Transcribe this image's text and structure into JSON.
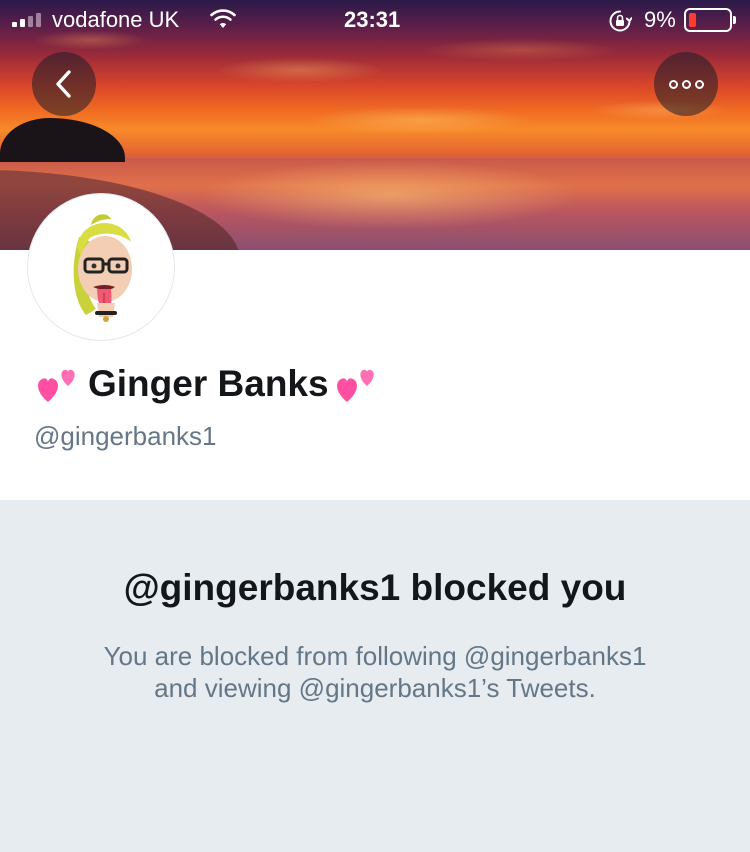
{
  "status_bar": {
    "carrier": "vodafone UK",
    "time": "23:31",
    "battery_percent": "9%",
    "battery_level": 0.09,
    "icons": [
      "signal-icon",
      "wifi-icon",
      "orientation-lock-icon",
      "battery-icon"
    ]
  },
  "header": {
    "back_icon": "chevron-left-icon",
    "more_icon": "more-options-icon"
  },
  "profile": {
    "display_name": "Ginger Banks",
    "name_decoration_icon": "two-hearts-emoji-icon",
    "handle": "@gingerbanks1"
  },
  "blocked_notice": {
    "title": "@gingerbanks1 blocked you",
    "line1": "You are blocked from following @gingerbanks1",
    "line2": "and viewing @gingerbanks1’s Tweets."
  },
  "colors": {
    "text_primary": "#14171a",
    "text_secondary": "#657786",
    "background_gray": "#e6ecf0",
    "battery_low": "#ff3b30",
    "heart_pink": "#ff4fa3"
  }
}
